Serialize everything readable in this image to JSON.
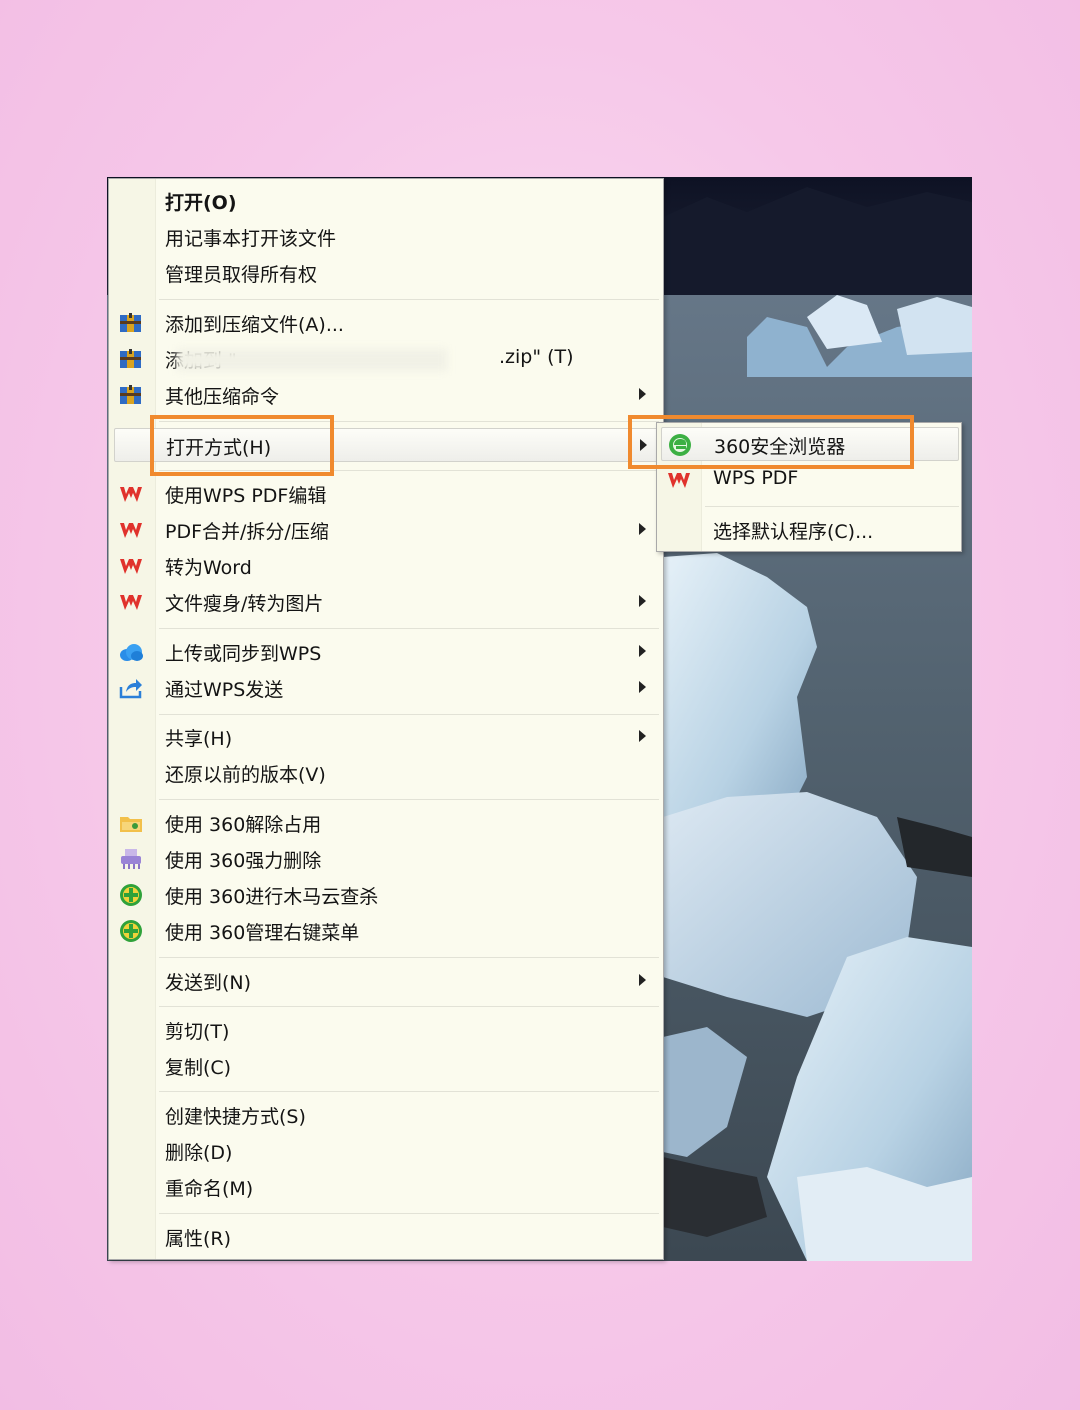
{
  "context_menu": {
    "items": [
      {
        "label": "打开(O)",
        "bold": true
      },
      {
        "label": "用记事本打开该文件"
      },
      {
        "label": "管理员取得所有权"
      },
      {
        "label": "添加到压缩文件(A)...",
        "icon": "archive-icon"
      },
      {
        "label": "添加到 \"",
        "suffix": ".zip\" (T)",
        "icon": "archive-icon"
      },
      {
        "label": "其他压缩命令",
        "icon": "archive-icon",
        "submenu": true
      },
      {
        "label": "打开方式(H)",
        "submenu": true,
        "highlighted": true
      },
      {
        "label": "使用WPS PDF编辑",
        "icon": "wps-icon"
      },
      {
        "label": "PDF合并/拆分/压缩",
        "icon": "wps-icon",
        "submenu": true
      },
      {
        "label": "转为Word",
        "icon": "wps-icon"
      },
      {
        "label": "文件瘦身/转为图片",
        "icon": "wps-icon",
        "submenu": true
      },
      {
        "label": "上传或同步到WPS",
        "icon": "cloud-icon",
        "submenu": true
      },
      {
        "label": "通过WPS发送",
        "icon": "share-icon",
        "submenu": true
      },
      {
        "label": "共享(H)",
        "submenu": true
      },
      {
        "label": "还原以前的版本(V)"
      },
      {
        "label": "使用 360解除占用",
        "icon": "folder-unlock-icon"
      },
      {
        "label": "使用 360强力删除",
        "icon": "shredder-icon"
      },
      {
        "label": "使用 360进行木马云查杀",
        "icon": "360-guard-icon"
      },
      {
        "label": "使用 360管理右键菜单",
        "icon": "360-guard-icon"
      },
      {
        "label": "发送到(N)",
        "submenu": true
      },
      {
        "label": "剪切(T)"
      },
      {
        "label": "复制(C)"
      },
      {
        "label": "创建快捷方式(S)"
      },
      {
        "label": "删除(D)"
      },
      {
        "label": "重命名(M)"
      },
      {
        "label": "属性(R)"
      }
    ]
  },
  "open_with_submenu": {
    "items": [
      {
        "label": "360安全浏览器",
        "icon": "360-browser-icon",
        "highlighted": true
      },
      {
        "label": "WPS PDF",
        "icon": "wps-icon"
      },
      {
        "label": "选择默认程序(C)..."
      }
    ]
  },
  "colors": {
    "menu_background": "#fbfbee",
    "highlight_box": "#f08a2e",
    "wps_red": "#e0322c"
  }
}
